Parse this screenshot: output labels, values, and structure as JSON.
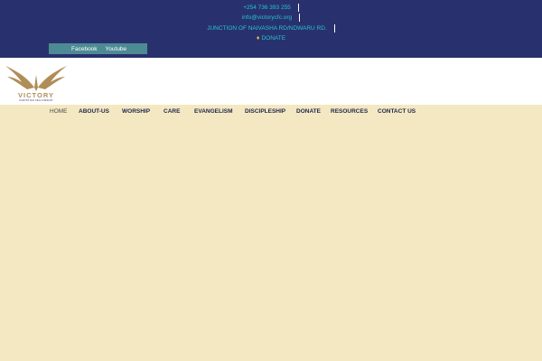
{
  "header": {
    "phone": "+254 736 393 255",
    "email": "info@victorycfc.org",
    "address": "JUNCTION OF NAIVASHA RD/NDWARU RD.",
    "donate_label": "DONATE",
    "donate_icon": "donate-icon"
  },
  "social": {
    "items": [
      {
        "label": "Facebook"
      },
      {
        "label": "Youtube"
      }
    ]
  },
  "logo": {
    "word": "VICTORY",
    "sub": "CHRISTIAN FELLOWSHIP",
    "icon": "wings-icon"
  },
  "nav": {
    "items": [
      {
        "label": "HOME",
        "active": true
      },
      {
        "label": "ABOUT-US"
      },
      {
        "label": "WORSHIP"
      },
      {
        "label": "CARE"
      },
      {
        "label": "EVANGELISM"
      },
      {
        "label": "DISCIPLESHIP"
      },
      {
        "label": "DONATE"
      },
      {
        "label": "RESOURCES"
      },
      {
        "label": "CONTACT US"
      }
    ]
  },
  "colors": {
    "header_bg": "#28316d",
    "contact_text": "#27c4ce",
    "social_bg": "#4d8b94",
    "page_bg": "#f3e8c1",
    "logo_gold": "#b08d57",
    "nav_text": "#1f2550"
  }
}
